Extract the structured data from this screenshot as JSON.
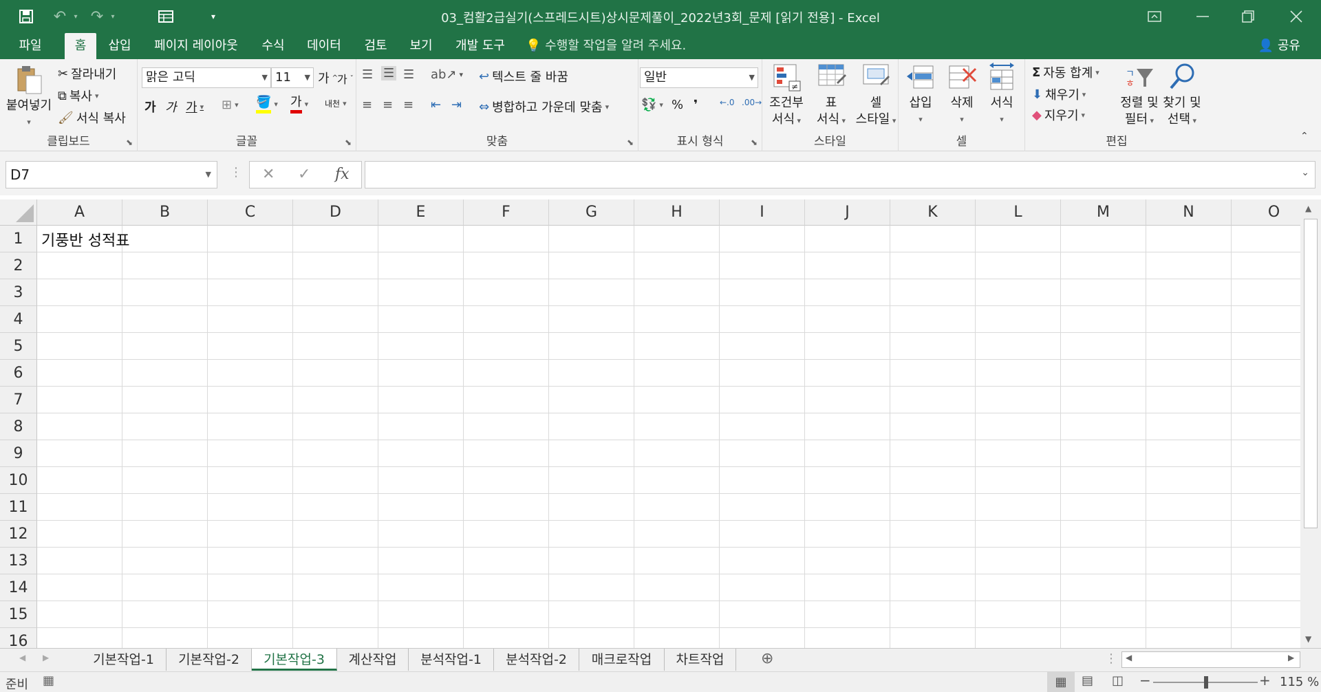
{
  "window": {
    "title": "03_컴활2급실기(스프레드시트)상시문제풀이_2022년3회_문제  [읽기 전용] - Excel"
  },
  "qat": {
    "save_icon": "save-icon",
    "undo_icon": "undo-icon",
    "redo_icon": "redo-icon",
    "form_icon": "form-icon"
  },
  "tabs": [
    "파일",
    "홈",
    "삽입",
    "페이지 레이아웃",
    "수식",
    "데이터",
    "검토",
    "보기",
    "개발 도구"
  ],
  "active_tab": "홈",
  "tell_me": "수행할 작업을 알려 주세요.",
  "share": "공유",
  "clipboard": {
    "paste": "붙여넣기",
    "cut": "잘라내기",
    "copy": "복사",
    "format_painter": "서식 복사",
    "label": "클립보드"
  },
  "font": {
    "name": "맑은 고딕",
    "size": "11",
    "grow": "가",
    "shrink": "가",
    "bold": "가",
    "italic": "가",
    "underline": "가",
    "color_glyph": "가",
    "phonetic": "내천",
    "label": "글꼴"
  },
  "alignment": {
    "wrap": "텍스트 줄 바꿈",
    "merge": "병합하고 가운데 맞춤",
    "label": "맞춤"
  },
  "number": {
    "format": "일반",
    "percent": "%",
    "comma": "❜",
    "label": "표시 형식"
  },
  "styles": {
    "conditional": [
      "조건부",
      "서식"
    ],
    "table": [
      "표",
      "서식"
    ],
    "cell": [
      "셀",
      "스타일"
    ],
    "label": "스타일"
  },
  "cells": {
    "insert": "삽입",
    "delete": "삭제",
    "format": "서식",
    "label": "셀"
  },
  "editing": {
    "autosum": "자동 합계",
    "fill": "채우기",
    "clear": "지우기",
    "sort": [
      "정렬 및",
      "필터"
    ],
    "find": [
      "찾기 및",
      "선택"
    ],
    "label": "편집"
  },
  "formula_bar": {
    "name_box": "D7",
    "formula": ""
  },
  "columns": [
    "A",
    "B",
    "C",
    "D",
    "E",
    "F",
    "G",
    "H",
    "I",
    "J",
    "K",
    "L",
    "M",
    "N",
    "O"
  ],
  "rows": [
    "1",
    "2",
    "3",
    "4",
    "5",
    "6",
    "7",
    "8",
    "9",
    "10",
    "11",
    "12",
    "13",
    "14",
    "15",
    "16"
  ],
  "cell_values": {
    "A1": "기풍반 성적표"
  },
  "sheets": [
    "기본작업-1",
    "기본작업-2",
    "기본작업-3",
    "계산작업",
    "분석작업-1",
    "분석작업-2",
    "매크로작업",
    "차트작업"
  ],
  "active_sheet": "기본작업-3",
  "status": {
    "ready": "준비",
    "zoom": "115 %"
  }
}
